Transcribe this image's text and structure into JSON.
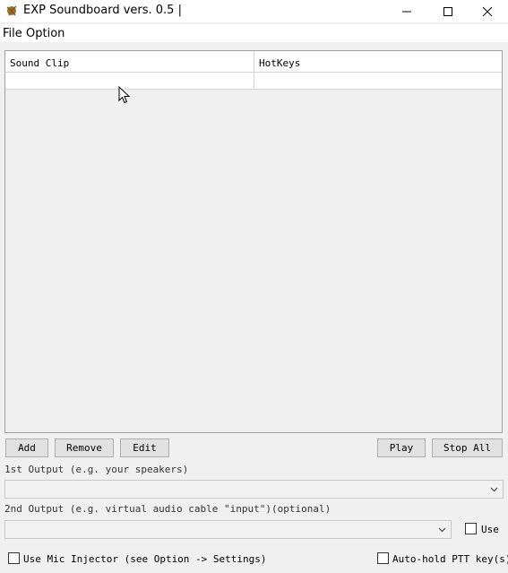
{
  "window": {
    "title": "EXP Soundboard vers. 0.5 |"
  },
  "menu": {
    "file": "File",
    "option": "Option"
  },
  "table": {
    "columns": [
      "Sound Clip",
      "HotKeys"
    ]
  },
  "buttons": {
    "add": "Add",
    "remove": "Remove",
    "edit": "Edit",
    "play": "Play",
    "stop_all": "Stop All"
  },
  "outputs": {
    "first_label": "1st Output (e.g. your speakers)",
    "second_label": "2nd Output (e.g. virtual audio cable \"input\")(optional)",
    "use_label": "Use"
  },
  "options": {
    "mic_injector": "Use Mic Injector (see Option -> Settings)",
    "auto_hold": "Auto-hold PTT key(s)"
  }
}
